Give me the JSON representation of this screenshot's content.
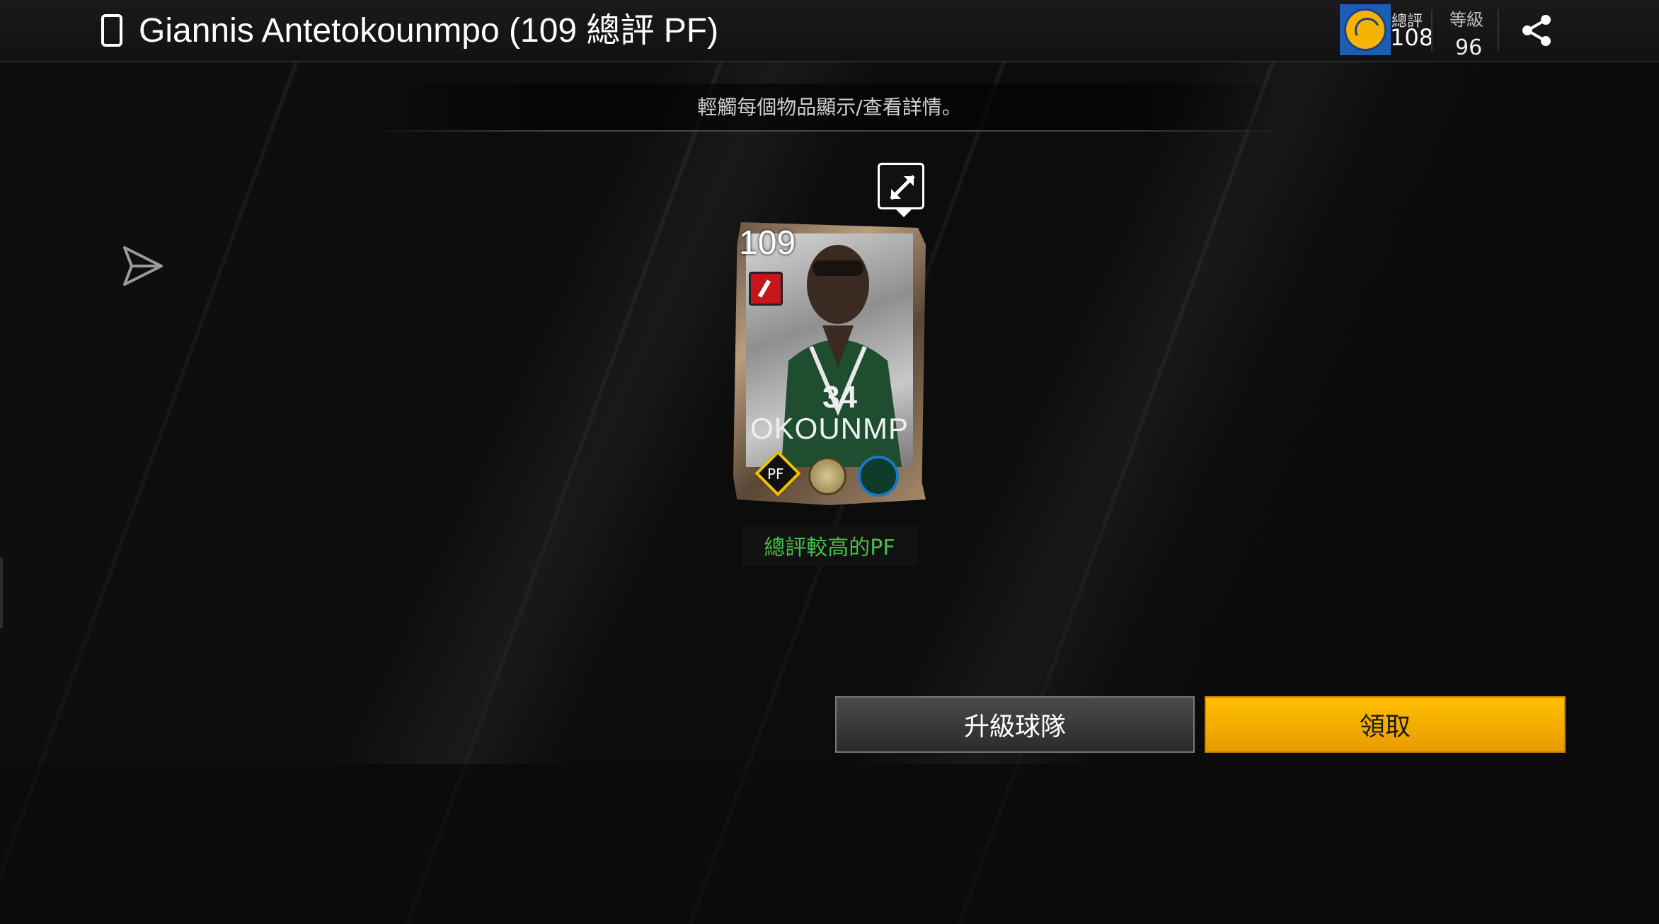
{
  "header": {
    "title": "Giannis Antetokounmpo (109 總評 PF)",
    "team_ovr_label": "總評",
    "team_ovr_value": "108",
    "level_label": "等級",
    "level_value": "96"
  },
  "subheader": {
    "instruction": "輕觸每個物品顯示/查看詳情。"
  },
  "card": {
    "overall": "109",
    "name_visible": "OKOUNMP",
    "position": "PF",
    "rank_note": "總評較高的PF"
  },
  "buttons": {
    "upgrade_label": "升級球隊",
    "claim_label": "領取"
  },
  "colors": {
    "accent": "#f2a700",
    "highlight_green": "#42c24a",
    "team_blue": "#1a5fb4"
  }
}
